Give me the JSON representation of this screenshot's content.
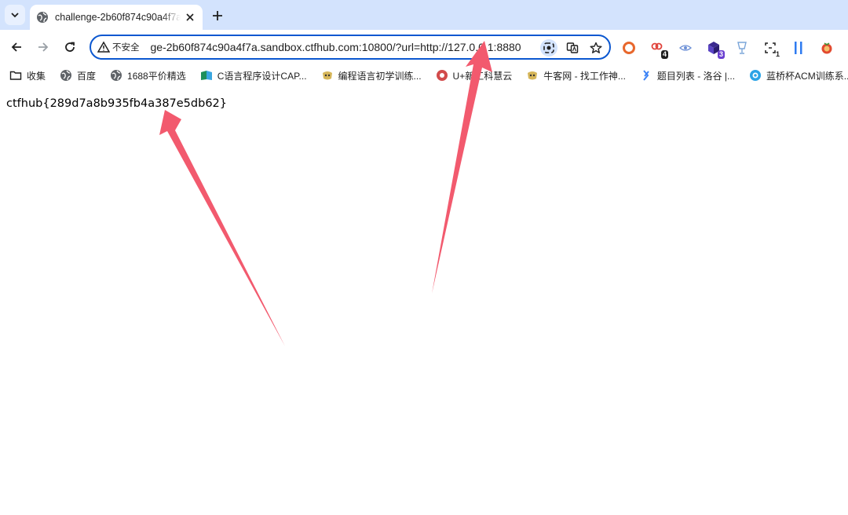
{
  "tab": {
    "title": "challenge-2b60f874c90a4f7a.sandbox.ctfhub.com"
  },
  "omnibox": {
    "security_label": "不安全",
    "url": "ge-2b60f874c90a4f7a.sandbox.ctfhub.com:10800/?url=http://127.0.0.1:8880"
  },
  "extensions": [
    {
      "icon": "ring-icon",
      "badge": ""
    },
    {
      "icon": "link-icon",
      "badge": "4"
    },
    {
      "icon": "eye-icon",
      "badge": ""
    },
    {
      "icon": "cube-icon",
      "badge": "3"
    },
    {
      "icon": "cup-icon",
      "badge": ""
    },
    {
      "icon": "capture-icon",
      "badge": "1"
    },
    {
      "icon": "pause-icon",
      "badge": ""
    },
    {
      "icon": "tomato-icon",
      "badge": ""
    }
  ],
  "bookmarks": [
    {
      "label": "收集",
      "icon": "folder-icon"
    },
    {
      "label": "百度",
      "icon": "globe-icon"
    },
    {
      "label": "1688平价精选",
      "icon": "globe-icon"
    },
    {
      "label": "C语言程序设计CAP...",
      "icon": "mooc-icon"
    },
    {
      "label": "编程语言初学训练...",
      "icon": "nowcoder-icon"
    },
    {
      "label": "U+新工科慧云",
      "icon": "uplus-icon"
    },
    {
      "label": "牛客网 - 找工作神...",
      "icon": "nowcoder-icon"
    },
    {
      "label": "题目列表 - 洛谷 |...",
      "icon": "luogu-icon"
    },
    {
      "label": "蓝桥杯ACM训练系...",
      "icon": "lanqiao-icon"
    }
  ],
  "page": {
    "text": "ctfhub{289d7a8b935fb4a387e5db62}"
  },
  "colors": {
    "accent": "#0b57d0",
    "tabstrip": "#d3e3fd",
    "annotation_arrow": "#f25a6e"
  }
}
